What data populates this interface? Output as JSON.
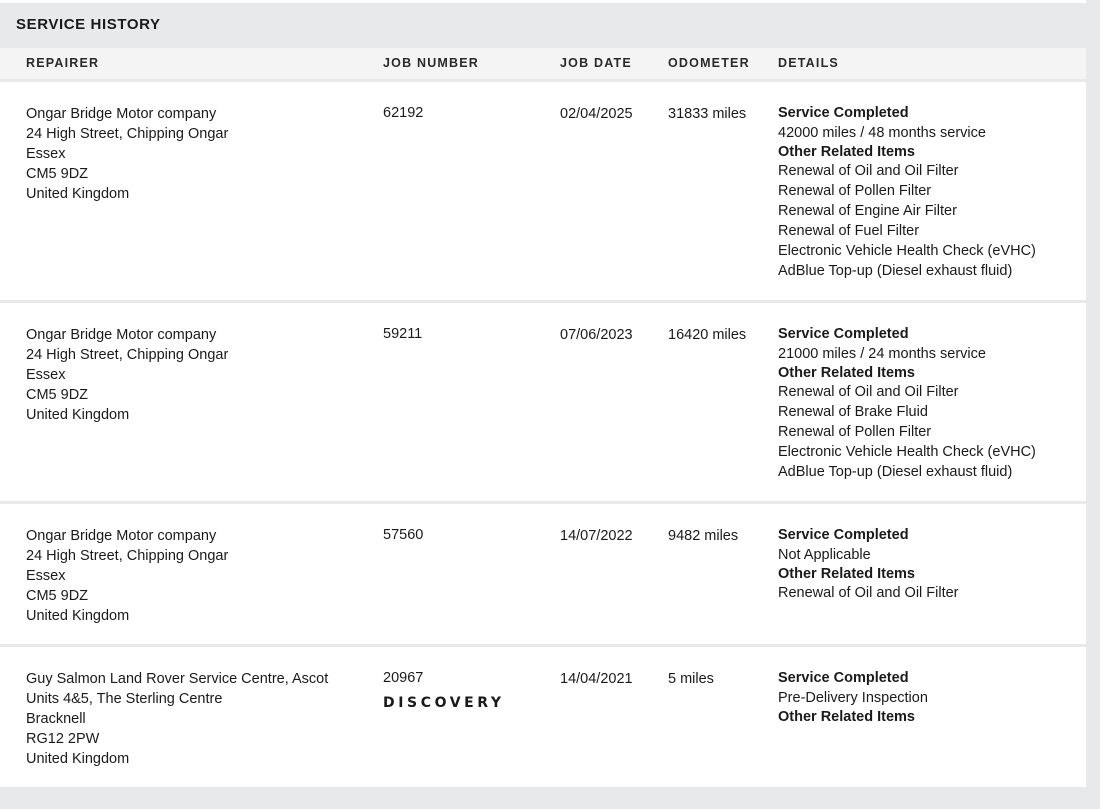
{
  "section": {
    "title": "SERVICE HISTORY"
  },
  "columns": {
    "repairer": "REPAIRER",
    "job_number": "JOB NUMBER",
    "job_date": "JOB DATE",
    "odometer": "ODOMETER",
    "details": "DETAILS"
  },
  "rows": [
    {
      "repairer": [
        "Ongar Bridge Motor company",
        "24 High Street, Chipping Ongar",
        "Essex",
        "CM5 9DZ",
        "United Kingdom"
      ],
      "job_number": "62192",
      "job_date": "02/04/2025",
      "odometer": "31833 miles",
      "service_heading": "Service Completed",
      "service_value": "42000 miles / 48 months service",
      "other_heading": "Other Related Items",
      "other_items": [
        "Renewal of Oil and Oil Filter",
        "Renewal of Pollen Filter",
        "Renewal of Engine Air Filter",
        "Renewal of Fuel Filter",
        "Electronic Vehicle Health Check (eVHC)",
        "AdBlue Top-up (Diesel exhaust fluid)"
      ]
    },
    {
      "repairer": [
        "Ongar Bridge Motor company",
        "24 High Street, Chipping Ongar",
        "Essex",
        "CM5 9DZ",
        "United Kingdom"
      ],
      "job_number": "59211",
      "job_date": "07/06/2023",
      "odometer": "16420 miles",
      "service_heading": "Service Completed",
      "service_value": "21000 miles / 24 months service",
      "other_heading": "Other Related Items",
      "other_items": [
        "Renewal of Oil and Oil Filter",
        "Renewal of Brake Fluid",
        "Renewal of Pollen Filter",
        "Electronic Vehicle Health Check (eVHC)",
        "AdBlue Top-up (Diesel exhaust fluid)"
      ]
    },
    {
      "repairer": [
        "Ongar Bridge Motor company",
        "24 High Street, Chipping Ongar",
        "Essex",
        "CM5 9DZ",
        "United Kingdom"
      ],
      "job_number": "57560",
      "job_date": "14/07/2022",
      "odometer": "9482 miles",
      "service_heading": "Service Completed",
      "service_value": "Not Applicable",
      "other_heading": "Other Related Items",
      "other_items": [
        "Renewal of Oil and Oil Filter"
      ]
    },
    {
      "repairer": [
        "Guy Salmon Land Rover Service Centre, Ascot",
        "Units 4&5, The Sterling Centre",
        "Bracknell",
        "RG12 2PW",
        "United Kingdom"
      ],
      "job_number": "20967",
      "brand_logo": "DISCOVERY",
      "job_date": "14/04/2021",
      "odometer": "5 miles",
      "service_heading": "Service Completed",
      "service_value": "Pre-Delivery Inspection",
      "other_heading": "Other Related Items",
      "other_items": []
    }
  ]
}
